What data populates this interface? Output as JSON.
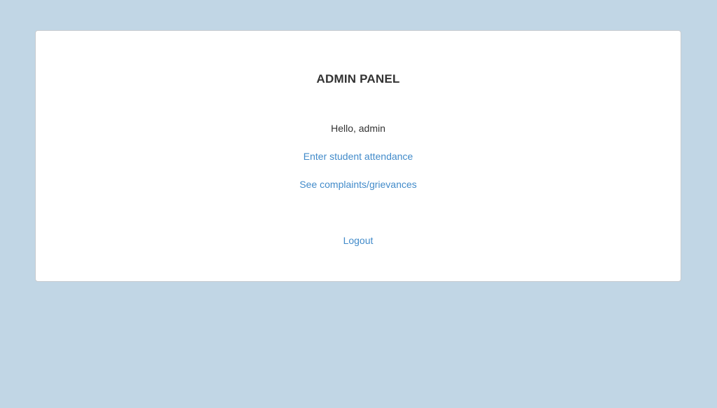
{
  "panel": {
    "title": "ADMIN PANEL",
    "greeting": "Hello, admin",
    "links": {
      "attendance": "Enter student attendance",
      "complaints": "See complaints/grievances",
      "logout": "Logout"
    }
  },
  "colors": {
    "background": "#c1d6e5",
    "panel": "#ffffff",
    "text": "#333333",
    "link": "#428bca"
  }
}
